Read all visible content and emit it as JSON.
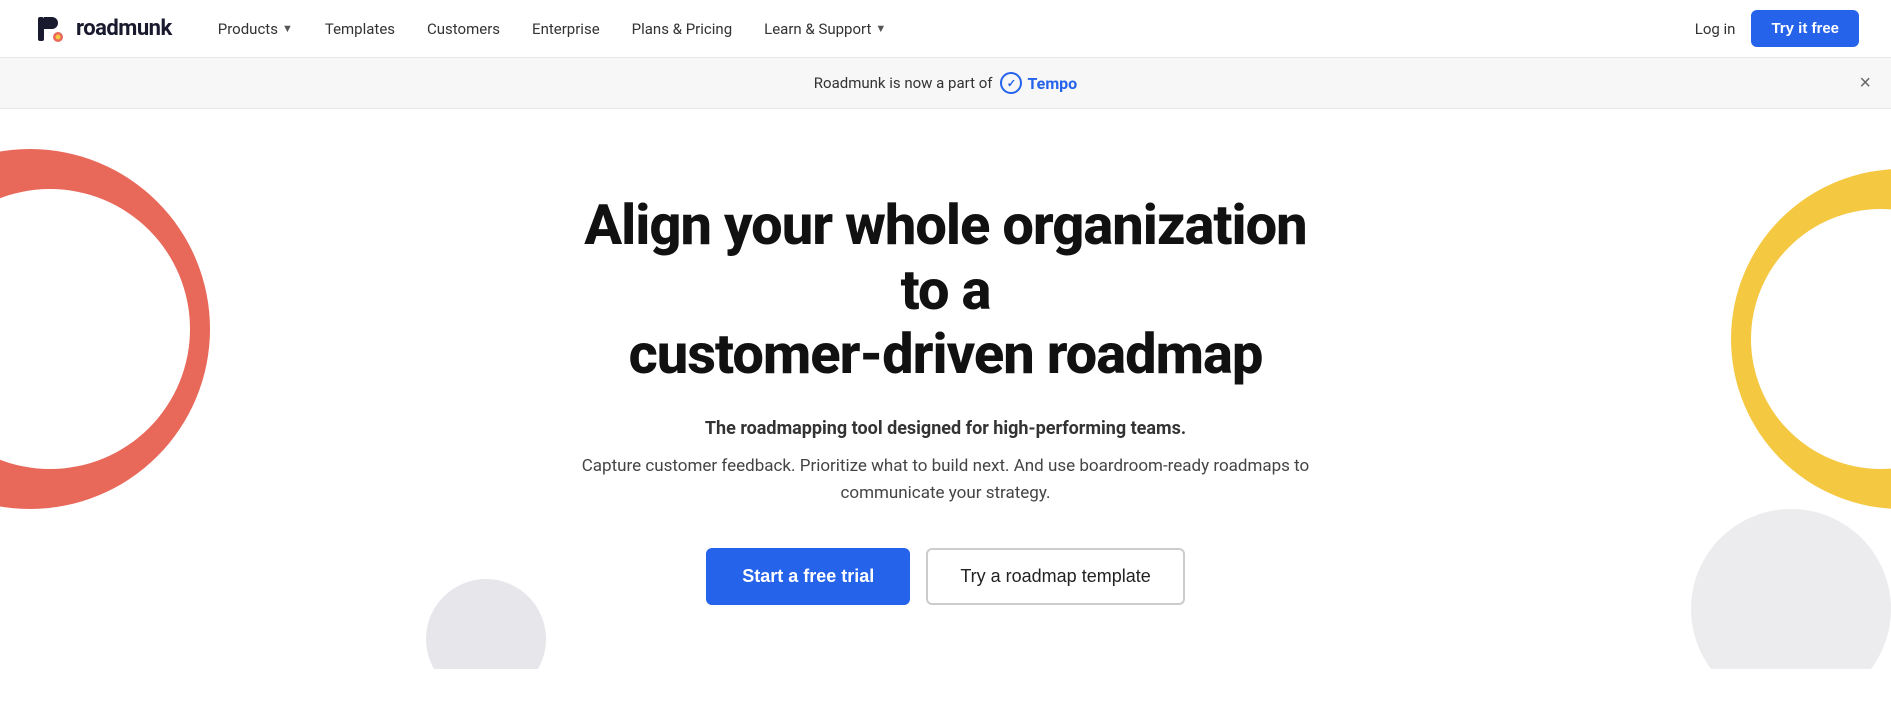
{
  "navbar": {
    "logo_text": "roadmunk",
    "nav_items": [
      {
        "label": "Products",
        "has_chevron": true
      },
      {
        "label": "Templates",
        "has_chevron": false
      },
      {
        "label": "Customers",
        "has_chevron": false
      },
      {
        "label": "Enterprise",
        "has_chevron": false
      },
      {
        "label": "Plans & Pricing",
        "has_chevron": false
      },
      {
        "label": "Learn & Support",
        "has_chevron": true
      }
    ],
    "login_label": "Log in",
    "try_free_label": "Try it free"
  },
  "banner": {
    "text": "Roadmunk is now a part of",
    "tempo_name": "Tempo",
    "close_label": "×"
  },
  "hero": {
    "title_line1": "Align your whole organization to a",
    "title_line2": "customer-driven roadmap",
    "subtitle": "The roadmapping tool designed for high-performing teams.",
    "body": "Capture customer feedback. Prioritize what to build next. And use boardroom-ready roadmaps to communicate your strategy.",
    "btn_primary": "Start a free trial",
    "btn_secondary": "Try a roadmap template"
  }
}
